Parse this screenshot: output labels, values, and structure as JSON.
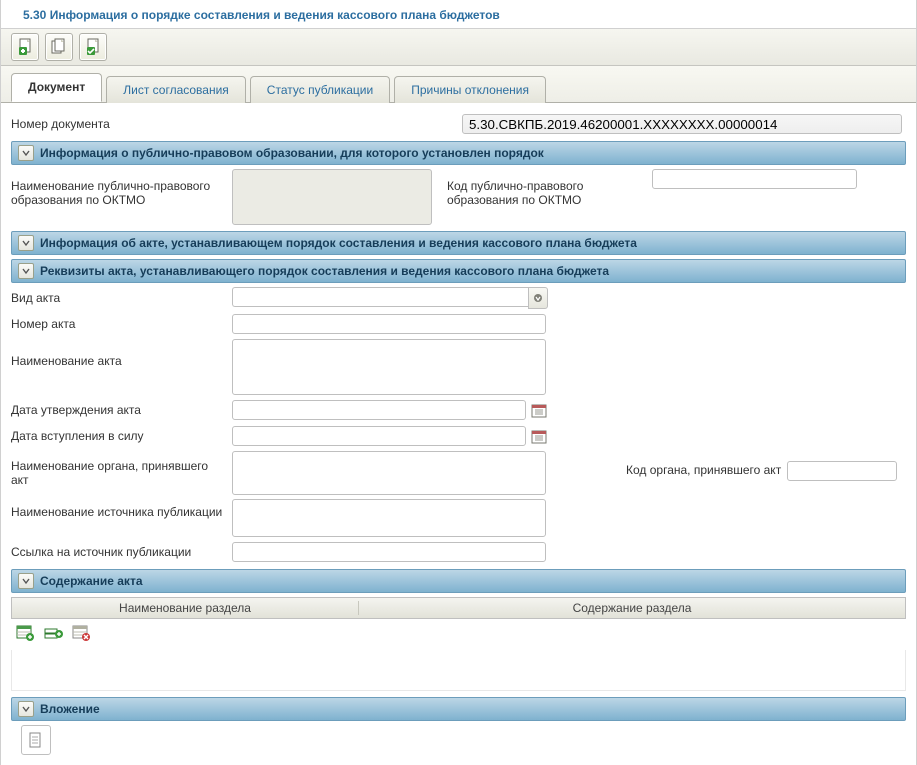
{
  "title": "5.30 Информация о порядке составления и ведения кассового плана бюджетов",
  "tabs": {
    "document": "Документ",
    "approval": "Лист согласования",
    "pub_status": "Статус публикации",
    "reject_reasons": "Причины отклонения"
  },
  "doc_number_label": "Номер документа",
  "doc_number_value": "5.30.СВКПБ.2019.46200001.ХХХХХХХХ.00000014",
  "sections": {
    "ppo": "Информация о публично-правовом образовании, для которого установлен порядок",
    "act": "Информация об акте, устанавливающем порядок составления и ведения кассового плана бюджета",
    "req": "Реквизиты акта, устанавливающего порядок составления и ведения кассового плана бюджета",
    "content": "Содержание акта",
    "attach": "Вложение"
  },
  "labels": {
    "ppo_name": "Наименование публично-правового образования по ОКТМО",
    "ppo_code": "Код публично-правового образования по ОКТМО",
    "act_type": "Вид акта",
    "act_number": "Номер акта",
    "act_name": "Наименование акта",
    "act_approve_date": "Дата утверждения акта",
    "act_effect_date": "Дата вступления в силу",
    "authority_name": "Наименование органа, принявшего акт",
    "authority_code": "Код органа, принявшего акт",
    "pub_source_name": "Наименование источника публикации",
    "pub_source_link": "Ссылка на источник публикации"
  },
  "grid": {
    "col_section_name": "Наименование раздела",
    "col_section_content": "Содержание раздела"
  },
  "values": {
    "ppo_name": "",
    "ppo_code": "",
    "act_type": "",
    "act_number": "",
    "act_name": "",
    "act_approve_date": "",
    "act_effect_date": "",
    "authority_name": "",
    "authority_code": "",
    "pub_source_name": "",
    "pub_source_link": ""
  }
}
